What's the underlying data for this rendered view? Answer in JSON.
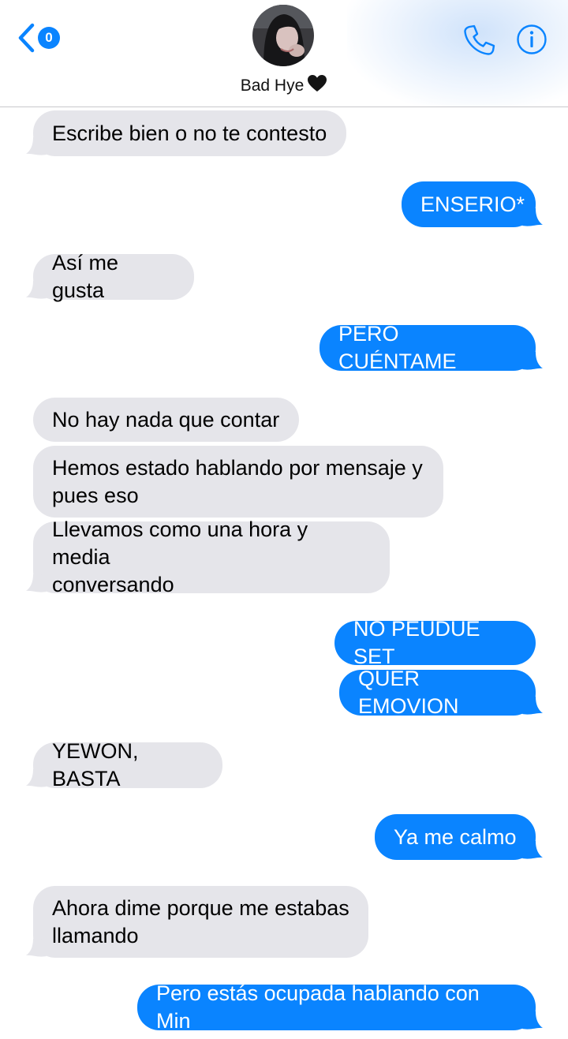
{
  "header": {
    "back_count": "0",
    "contact_name": "Bad Hye",
    "icons": {
      "back": "chevron-left-icon",
      "call": "phone-icon",
      "info": "info-icon",
      "status": "black-heart-icon"
    }
  },
  "colors": {
    "incoming_bubble": "#e5e5ea",
    "outgoing_bubble": "#0a84ff",
    "accent": "#0a84ff"
  },
  "messages": [
    {
      "from": "them",
      "text": "Escribe bien o no te contesto"
    },
    {
      "from": "me",
      "text": "ENSERIO*"
    },
    {
      "from": "them",
      "text": "Así me gusta"
    },
    {
      "from": "me",
      "text": "PERO CUÉNTAME"
    },
    {
      "from": "them",
      "text": "No hay nada que contar"
    },
    {
      "from": "them",
      "text": "Hemos estado hablando por mensaje y\npues eso"
    },
    {
      "from": "them",
      "text": "Llevamos como una hora y media\nconversando"
    },
    {
      "from": "me",
      "text": "NO PEUDUE SET"
    },
    {
      "from": "me",
      "text": "QUER EMOVION"
    },
    {
      "from": "them",
      "text": "YEWON, BASTA"
    },
    {
      "from": "me",
      "text": "Ya me calmo"
    },
    {
      "from": "them",
      "text": "Ahora dime porque me estabas\nllamando"
    },
    {
      "from": "me",
      "text": "Pero estás ocupada hablando con Min"
    }
  ]
}
